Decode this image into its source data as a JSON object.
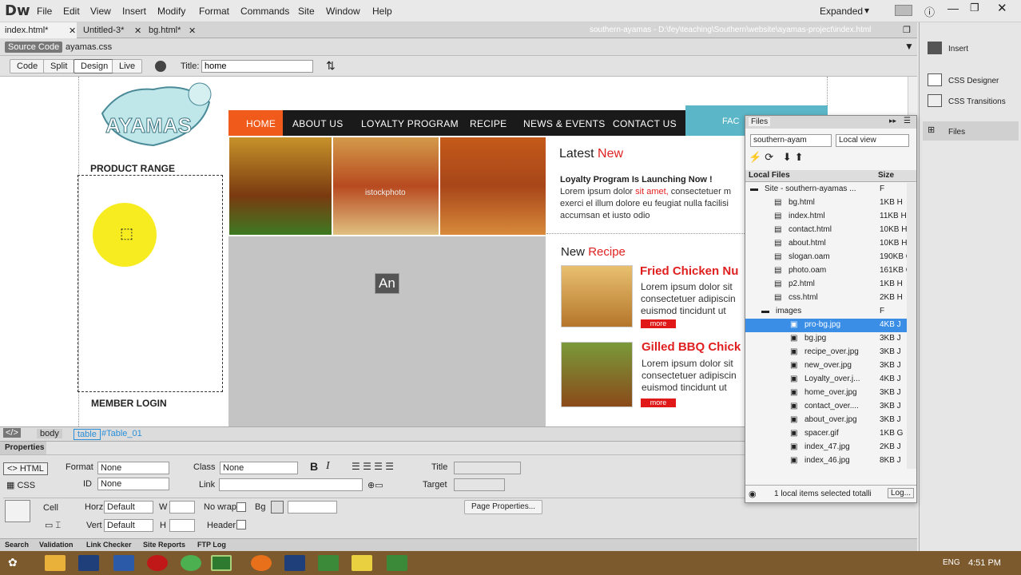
{
  "app": {
    "logo": "Dw",
    "menus": [
      "File",
      "Edit",
      "View",
      "Insert",
      "Modify",
      "Format",
      "Commands",
      "Site",
      "Window",
      "Help"
    ],
    "workspace": "Expanded"
  },
  "doc_tabs": [
    "index.html*",
    "Untitled-3*",
    "bg.html*"
  ],
  "path": "southern-ayamas - D:\\fey\\teaching\\Southern\\website\\ayamas-project\\index.html",
  "source": {
    "label": "Source Code",
    "file": "ayamas.css"
  },
  "toolbar": {
    "code": "Code",
    "split": "Split",
    "design": "Design",
    "live": "Live",
    "title_label": "Title:",
    "title_value": "home"
  },
  "page": {
    "logo": "AYAMAS",
    "nav": [
      "HOME",
      "ABOUT US",
      "LOYALTY PROGRAM",
      "RECIPE",
      "NEWS & EVENTS",
      "CONTACT US"
    ],
    "product_range": "PRODUCT RANGE",
    "member_login": "MEMBER LOGIN",
    "latest_a": "Latest",
    "latest_b": "New",
    "loyalty_title": "Loyalty Program Is Launching Now !",
    "loyalty_text1": "Lorem ipsum dolor",
    "loyalty_red": "sit amet,",
    "loyalty_text2": "consectetuer m",
    "loyalty_line2": "exerci el illum dolore eu feugiat nulla facilisi",
    "loyalty_line3": "accumsan et iusto odio",
    "new_a": "New",
    "new_b": "Recipe",
    "recipe1_title": "Fried Chicken Nu",
    "recipe2_title": "Gilled BBQ Chick",
    "recipe_l1": "Lorem ipsum dolor sit",
    "recipe_l2": "consectetuer adipiscin",
    "recipe_l3": "euismod tincidunt ut",
    "more": "more",
    "an": "An",
    "watermark": "istockphoto",
    "fb": "FAC"
  },
  "right_panel": [
    "Insert",
    "CSS Designer",
    "CSS Transitions",
    "Files"
  ],
  "files": {
    "tab": "Files",
    "site": "southern-ayam",
    "view": "Local view",
    "col_local": "Local Files",
    "col_size": "Size",
    "rows": [
      {
        "name": "Site - southern-ayamas ...",
        "size": "F",
        "type": "site"
      },
      {
        "name": "bg.html",
        "size": "1KB H",
        "type": "file"
      },
      {
        "name": "index.html",
        "size": "11KB H",
        "type": "file"
      },
      {
        "name": "contact.html",
        "size": "10KB H",
        "type": "file"
      },
      {
        "name": "about.html",
        "size": "10KB H",
        "type": "file"
      },
      {
        "name": "slogan.oam",
        "size": "190KB C",
        "type": "file"
      },
      {
        "name": "photo.oam",
        "size": "161KB C",
        "type": "file"
      },
      {
        "name": "p2.html",
        "size": "1KB H",
        "type": "file"
      },
      {
        "name": "css.html",
        "size": "2KB H",
        "type": "file"
      },
      {
        "name": "images",
        "size": "F",
        "type": "folder"
      },
      {
        "name": "pro-bg.jpg",
        "size": "4KB J",
        "type": "img",
        "selected": true
      },
      {
        "name": "bg.jpg",
        "size": "3KB J",
        "type": "img"
      },
      {
        "name": "recipe_over.jpg",
        "size": "3KB J",
        "type": "img"
      },
      {
        "name": "new_over.jpg",
        "size": "3KB J",
        "type": "img"
      },
      {
        "name": "Loyalty_over.j...",
        "size": "4KB J",
        "type": "img"
      },
      {
        "name": "home_over.jpg",
        "size": "3KB J",
        "type": "img"
      },
      {
        "name": "contact_over....",
        "size": "3KB J",
        "type": "img"
      },
      {
        "name": "about_over.jpg",
        "size": "3KB J",
        "type": "img"
      },
      {
        "name": "spacer.gif",
        "size": "1KB G",
        "type": "img"
      },
      {
        "name": "index_47.jpg",
        "size": "2KB J",
        "type": "img"
      },
      {
        "name": "index_46.jpg",
        "size": "8KB J",
        "type": "img"
      }
    ],
    "status": "1 local items selected totalli",
    "log": "Log..."
  },
  "tagbar": {
    "body": "body",
    "table": "table",
    "id": "#Table_01"
  },
  "properties": {
    "title": "Properties",
    "html": "HTML",
    "css": "CSS",
    "format": "Format",
    "format_val": "None",
    "id": "ID",
    "id_val": "None",
    "class": "Class",
    "class_val": "None",
    "link": "Link",
    "title_lbl": "Title",
    "target": "Target",
    "cell": "Cell",
    "horz": "Horz",
    "horz_val": "Default",
    "vert": "Vert",
    "vert_val": "Default",
    "w": "W",
    "h": "H",
    "nowrap": "No wrap",
    "bg": "Bg",
    "header": "Header",
    "page_props": "Page Properties..."
  },
  "bottom_tabs": [
    "Search",
    "Validation",
    "Link Checker",
    "Site Reports",
    "FTP Log"
  ],
  "tray": {
    "lang": "ENG",
    "time": "4:51 PM"
  }
}
